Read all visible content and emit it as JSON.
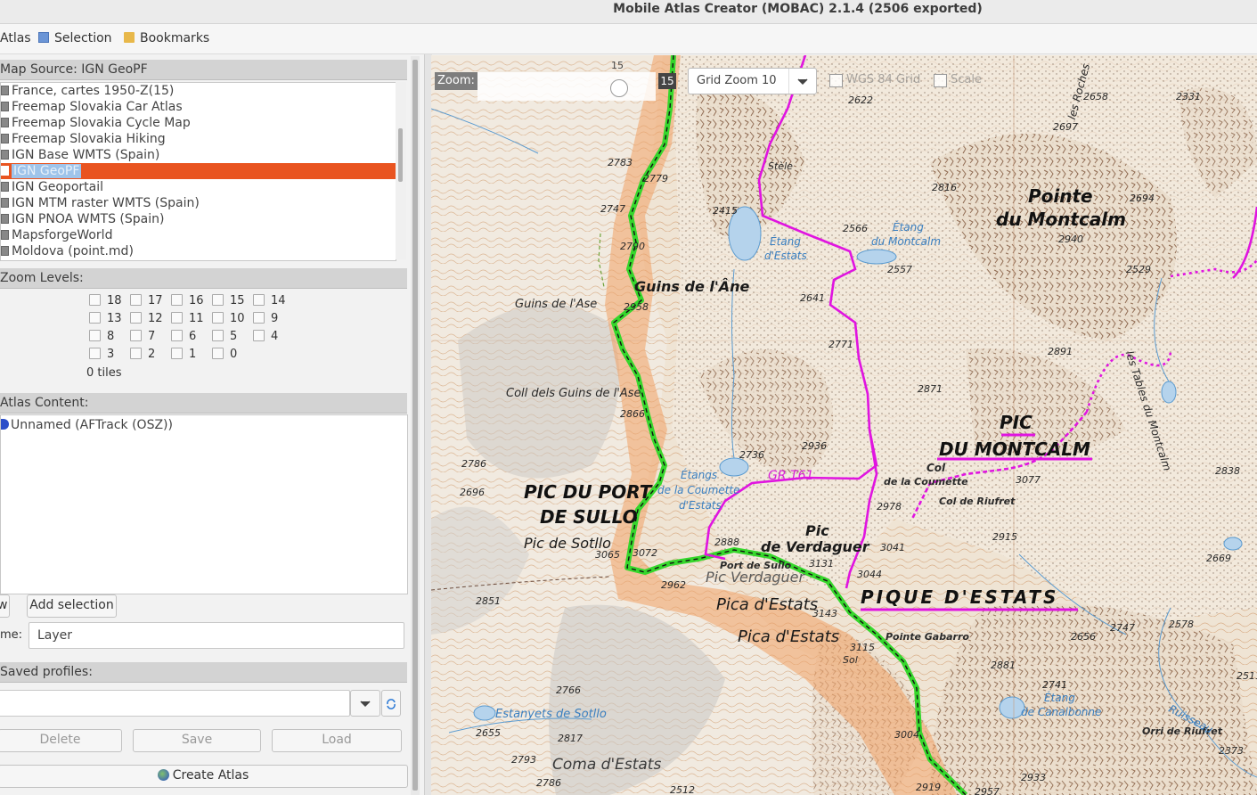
{
  "window": {
    "title": "Mobile Atlas Creator (MOBAC) 2.1.4 (2506 exported)"
  },
  "menubar": {
    "atlas": "Atlas",
    "selection": "Selection",
    "bookmarks": "Bookmarks"
  },
  "map_source": {
    "header": "Map Source: IGN GeoPF",
    "items": [
      "France, cartes 1950-Z(15)",
      "Freemap Slovakia Car Atlas",
      "Freemap Slovakia Cycle Map",
      "Freemap Slovakia Hiking",
      "IGN Base WMTS (Spain)",
      "IGN GeoPF",
      "IGN Geoportail",
      "IGN MTM raster WMTS (Spain)",
      "IGN PNOA WMTS (Spain)",
      "MapsforgeWorld",
      "Moldova (point.md)"
    ],
    "selected": "IGN GeoPF"
  },
  "zoom_levels": {
    "header": "Zoom Levels:",
    "levels": [
      "18",
      "17",
      "16",
      "15",
      "14",
      "13",
      "12",
      "11",
      "10",
      "9",
      "8",
      "7",
      "6",
      "5",
      "4",
      "3",
      "2",
      "1",
      "0"
    ],
    "tiles": "0 tiles"
  },
  "atlas_content": {
    "header": "Atlas Content:",
    "item": "Unnamed (AFTrack (OSZ))"
  },
  "layer": {
    "new_button": "w",
    "add_selection": "Add selection",
    "name_label": "me:",
    "name_value": "Layer"
  },
  "profiles": {
    "header": "Saved profiles:",
    "delete": "Delete",
    "save": "Save",
    "load": "Load"
  },
  "create_atlas": "Create Atlas",
  "map_controls": {
    "zoom_label": "Zoom:",
    "zoom_max": "15",
    "zoom_value": "15",
    "grid_zoom": "Grid Zoom 10",
    "wgs_grid": "WGS 84 Grid",
    "scale": "Scale"
  },
  "map_labels": {
    "pointe_montcalm_1": "Pointe",
    "pointe_montcalm_2": "du Montcalm",
    "pic_montcalm_1": "PIC",
    "pic_montcalm_2": "DU MONTCALM",
    "pic_port_sullo_1": "PIC DU PORT",
    "pic_port_sullo_2": "DE SULLO",
    "pic_sotllo": "Pic de Sotllo",
    "pique_estats": "PIQUE D'ESTATS",
    "pic_verdaguer_1": "Pic",
    "pic_verdaguer_2": "de Verdaguer",
    "pic_verdaguer_es": "Pic Verdaguer",
    "pica_estats_1": "Pica d'Estats",
    "pica_estats_2": "Pica d'Estats",
    "guins_ane": "Guins de l'Âne",
    "guins_ase": "Guins de l'Ase",
    "coll_guins": "Coll dels Guins de l'Ase",
    "col_coumette_1": "Col",
    "col_coumette_2": "de la Coumette",
    "col_riufret": "Col de Riufret",
    "port_sullo": "Port de Sullo",
    "pointe_gabarro": "Pointe Gabarro",
    "stele": "Stèle",
    "etang_estats_1": "Étang",
    "etang_estats_2": "d'Estats",
    "etang_montcalm_1": "Étang",
    "etang_montcalm_2": "du Montcalm",
    "etangs_coumette_1": "Étangs",
    "etangs_coumette_2": "de la Coumette",
    "etangs_coumette_3": "d'Estats",
    "etang_canalbonne_1": "Étang",
    "etang_canalbonne_2": "de Canalbonne",
    "estanyets_sotllo": "Estanyets de Sotllo",
    "coma_estats": "Coma d'Estats",
    "tables_montcalm": "les Tables du Montcalm",
    "roches": "les Roches",
    "orri_riufret": "Orri de Riufret",
    "ruisseau": "Ruisseau",
    "gr": "GR T61",
    "sol": "Sol",
    "spot_heights": [
      "2658",
      "2622",
      "2697",
      "2331",
      "2783",
      "2779",
      "2816",
      "2694",
      "2415",
      "2566",
      "2940",
      "2747",
      "2790",
      "2557",
      "2529",
      "2641",
      "2958",
      "2771",
      "2891",
      "2871",
      "2866",
      "2936",
      "2786",
      "2736",
      "2696",
      "3077",
      "2838",
      "2978",
      "2888",
      "2915",
      "3072",
      "3041",
      "3131",
      "2669",
      "3065",
      "3044",
      "2962",
      "2851",
      "3143",
      "2656",
      "2747",
      "2578",
      "3115",
      "2881",
      "2741",
      "2511",
      "2766",
      "2817",
      "3004",
      "2655",
      "2373",
      "2793",
      "2786",
      "2512",
      "2919",
      "2957",
      "2933"
    ]
  }
}
